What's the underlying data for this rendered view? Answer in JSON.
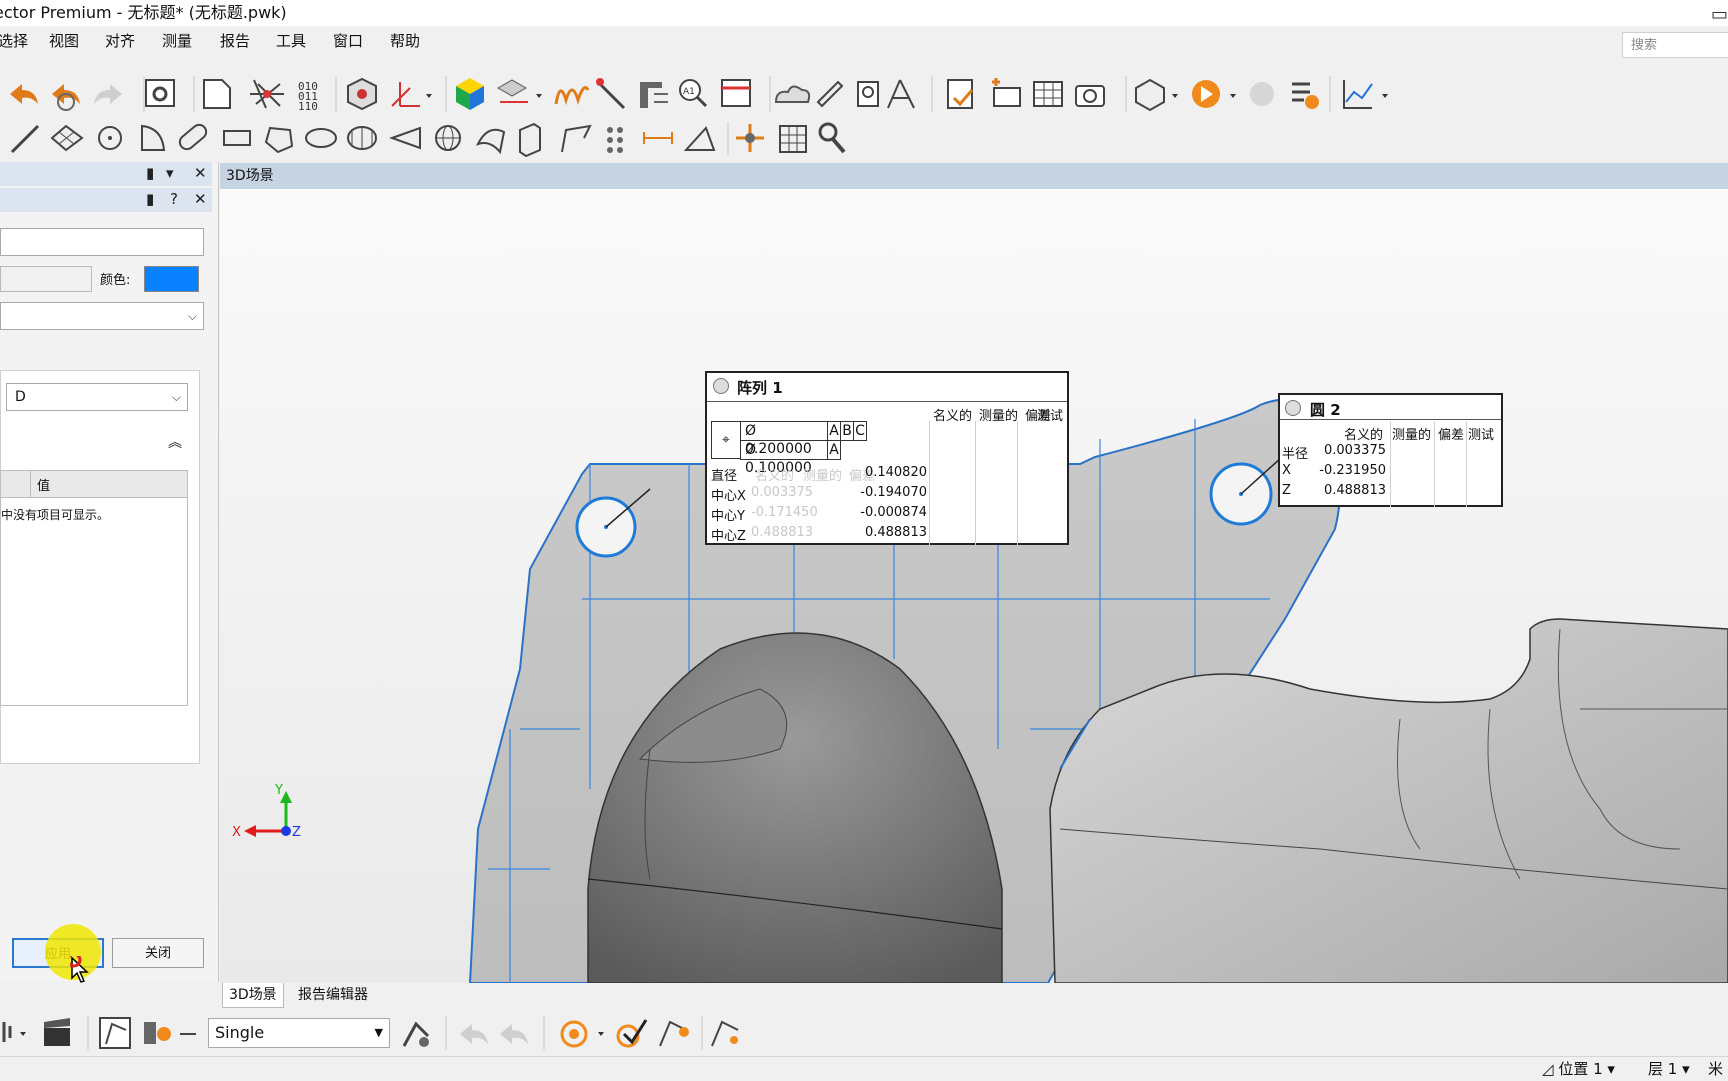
{
  "window": {
    "title": "ector Premium - 无标题* (无标题.pwk)"
  },
  "menu": [
    "选择",
    "视图",
    "对齐",
    "测量",
    "报告",
    "工具",
    "窗口",
    "帮助"
  ],
  "search": {
    "placeholder": "搜索"
  },
  "toolbar1": [
    "undo-icon",
    "undo-all-icon",
    "redo-icon",
    "options-icon",
    "new-page-icon",
    "explode-icon",
    "binary-icon",
    "cube-settings-icon",
    "axis-align-icon",
    "color-cube-icon",
    "surface-deviation-icon",
    "wave-icon",
    "probe-icon",
    "caliper-icon",
    "zoom-label-icon",
    "grid-label-icon",
    "cloud-icon",
    "pen-measure-icon",
    "hand-measure-icon",
    "compass-icon",
    "checklist-icon",
    "camera-plus-icon",
    "table-icon",
    "camera-icon",
    "report-export-icon",
    "play-icon",
    "hand-icon",
    "list-play-icon",
    "chart-icon"
  ],
  "toolbar2": [
    "line-icon",
    "plane-icon",
    "circle-icon",
    "arc-icon",
    "slot-icon",
    "rect-slot-icon",
    "polygon-icon",
    "ellipse-icon",
    "cylinder-icon",
    "cone-icon",
    "sphere-icon",
    "freeform-icon",
    "box-icon",
    "polyline-icon",
    "point-array-icon",
    "distance-icon",
    "angle-icon",
    "cross-section-icon",
    "grid-point-icon",
    "wrench-settings-icon"
  ],
  "left_panel": {
    "color_label": "颜色:",
    "combo_value": "D",
    "table_header_value": "值",
    "empty_message": "中没有项目可显示。",
    "apply_label": "应用",
    "close_label": "关闭"
  },
  "scene": {
    "title": "3D场景",
    "axes": {
      "x": "X",
      "y": "Y",
      "z": "Z"
    }
  },
  "callout_array": {
    "title": "阵列 1",
    "headers": [
      "名义的",
      "测量的",
      "偏差",
      "测试"
    ],
    "fcf_rows": [
      {
        "symbol": "Ø",
        "tolerance": "0.200000",
        "datums": [
          "A",
          "B",
          "C"
        ]
      },
      {
        "symbol": "Ø",
        "tolerance": "0.100000",
        "datums": [
          "A"
        ]
      }
    ],
    "ghost_headers": [
      "名义的",
      "测量的",
      "偏差"
    ],
    "rows": [
      {
        "label": "直径",
        "ghost": "",
        "value": "0.140820"
      },
      {
        "label": "中心X",
        "ghost": "0.003375",
        "value": "-0.194070"
      },
      {
        "label": "中心Y",
        "ghost": "-0.171450",
        "value": "-0.000874"
      },
      {
        "label": "中心Z",
        "ghost": "0.488813",
        "value": "0.488813"
      }
    ]
  },
  "callout_circle": {
    "title": "圆 2",
    "headers": [
      "名义的",
      "测量的",
      "偏差",
      "测试"
    ],
    "rows": [
      {
        "label": "半径",
        "value": "0.003375"
      },
      {
        "label": "X",
        "value": "-0.231950"
      },
      {
        "label": "Z",
        "value": "0.488813"
      }
    ]
  },
  "tabs": [
    "3D场景",
    "报告编辑器"
  ],
  "bottom": {
    "mode_value": "Single"
  },
  "status": {
    "position": "位置 1",
    "layer": "层 1",
    "unit": "米"
  },
  "colors": {
    "accent": "#0a82ff",
    "scene_header": "#c6d3e3",
    "circle_highlight": "#1e7bd8"
  }
}
